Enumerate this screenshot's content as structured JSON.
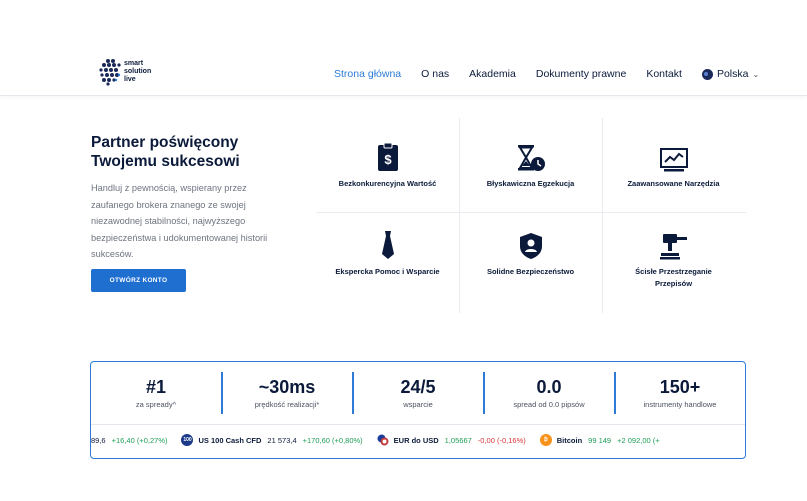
{
  "brand": {
    "line1": "smart",
    "line2": "solution",
    "line3": "live"
  },
  "nav": {
    "items": [
      "Strona główna",
      "O nas",
      "Akademia",
      "Dokumenty prawne",
      "Kontakt"
    ],
    "language": "Polska"
  },
  "hero": {
    "title_line1": "Partner poświęcony",
    "title_line2": "Twojemu sukcesowi",
    "description": "Handluj z pewnością, wspierany przez zaufanego brokera znanego ze swojej niezawodnej stabilności, najwyższego bezpieczeństwa i udokumentowanej historii sukcesów.",
    "cta": "OTWÓRZ KONTO"
  },
  "features": [
    {
      "label": "Bezkonkurencyjna Wartość",
      "icon": "dollar-clipboard-icon"
    },
    {
      "label": "Błyskawiczna Egzekucja",
      "icon": "hourglass-clock-icon"
    },
    {
      "label": "Zaawansowane Narzędzia",
      "icon": "chart-monitor-icon"
    },
    {
      "label": "Ekspercka Pomoc i Wsparcie",
      "icon": "necktie-icon"
    },
    {
      "label": "Solidne Bezpieczeństwo",
      "icon": "shield-user-icon"
    },
    {
      "label": "Ścisłe Przestrzeganie Przepisów",
      "icon": "gavel-icon"
    }
  ],
  "stats": [
    {
      "value": "#1",
      "caption": "za spready^"
    },
    {
      "value": "~30ms",
      "caption": "prędkość realizacji*"
    },
    {
      "value": "24/5",
      "caption": "wsparcie"
    },
    {
      "value": "0.0",
      "caption": "spread od 0.0 pipsów"
    },
    {
      "value": "150+",
      "caption": "instrumenty handlowe"
    }
  ],
  "ticker": [
    {
      "name": "",
      "price": "89,6",
      "change": "+16,40 (+0,27%)",
      "direction": "up",
      "icon": ""
    },
    {
      "name": "US 100 Cash CFD",
      "price": "21 573,4",
      "change": "+170,60 (+0,80%)",
      "direction": "up",
      "icon": "100",
      "color": "#1b3a8a"
    },
    {
      "name": "EUR do USD",
      "price": "1,05667",
      "change": "-0,00 (-0,16%)",
      "direction": "down",
      "icon": "",
      "color": "#c23a3a"
    },
    {
      "name": "Bitcoin",
      "price": "99 149",
      "change": "+2 092,00 (+",
      "direction": "up",
      "icon": "₿",
      "color": "#f7931a"
    }
  ],
  "colors": {
    "accent": "#1f6fd1",
    "navy": "#0b1a3a",
    "up": "#1e9e57",
    "down": "#d8363a"
  }
}
